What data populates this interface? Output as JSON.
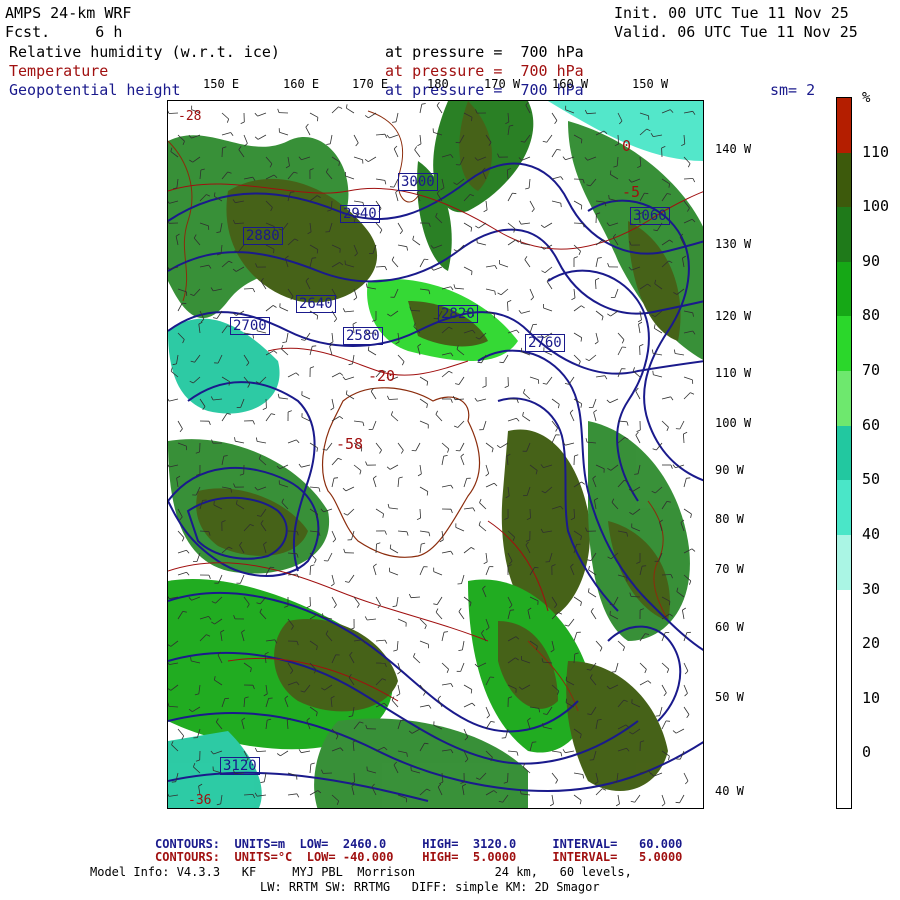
{
  "header": {
    "title": "AMPS 24-km WRF",
    "fcst": "Fcst.     6 h",
    "init": "Init. 00 UTC Tue 11 Nov 25",
    "valid": "Valid. 06 UTC Tue 11 Nov 25",
    "fields": [
      {
        "name": "Relative humidity (w.r.t. ice)",
        "level": "at pressure =  700 hPa",
        "color": "#000000"
      },
      {
        "name": "Temperature",
        "level": "at pressure =  700 hPa",
        "color": "#a01010"
      },
      {
        "name": "Geopotential height",
        "level": "at pressure =  700 hPa",
        "color": "#1a1a8c"
      }
    ],
    "smoothing": "sm= 2"
  },
  "map": {
    "lon_labels_top": [
      "150 E",
      "160 E",
      "170 E",
      "180",
      "170 W",
      "160 W",
      "150 W"
    ],
    "lat_labels_right": [
      "140 W",
      "130 W",
      "120 W",
      "110 W",
      "100 W",
      "90 W",
      "80 W",
      "70 W",
      "60 W",
      "50 W",
      "40 W"
    ],
    "height_contour_labels": [
      "3000",
      "2940",
      "2880",
      "2820",
      "2760",
      "2700",
      "2640",
      "2580",
      "3060",
      "3120"
    ],
    "temperature_labels": [
      "-58",
      "-20",
      "-5",
      "0",
      "-36",
      "-28"
    ],
    "colors": {
      "height_contour": "#1a1a8c",
      "temperature_contour": "#a01010",
      "coastline": "#8b2c0c",
      "wind_barb": "#303030"
    }
  },
  "colorbar": {
    "unit": "%",
    "labels": [
      "110",
      "100",
      "90",
      "80",
      "70",
      "60",
      "50",
      "40",
      "30",
      "20",
      "10",
      "0"
    ],
    "segments": [
      {
        "color": "#b41e00"
      },
      {
        "color": "#3d5a0c"
      },
      {
        "color": "#1f7a1a"
      },
      {
        "color": "#16a816"
      },
      {
        "color": "#2bd72b"
      },
      {
        "color": "#6ee86e"
      },
      {
        "color": "#22c8a0"
      },
      {
        "color": "#4ae6c8"
      },
      {
        "color": "#aaf5e4"
      },
      {
        "color": "#ffffff"
      },
      {
        "color": "#ffffff"
      },
      {
        "color": "#ffffff"
      },
      {
        "color": "#ffffff"
      }
    ]
  },
  "footer": {
    "contours_height": "CONTOURS:  UNITS=m  LOW=  2460.0     HIGH=  3120.0     INTERVAL=   60.000",
    "contours_temp": "CONTOURS:  UNITS=°C  LOW= -40.000    HIGH=  5.0000     INTERVAL=   5.0000",
    "model_info": "Model Info: V4.3.3   KF     MYJ PBL  Morrison           24 km,   60 levels,",
    "model_info2": "LW: RRTM SW: RRTMG   DIFF: simple KM: 2D Smagor"
  }
}
